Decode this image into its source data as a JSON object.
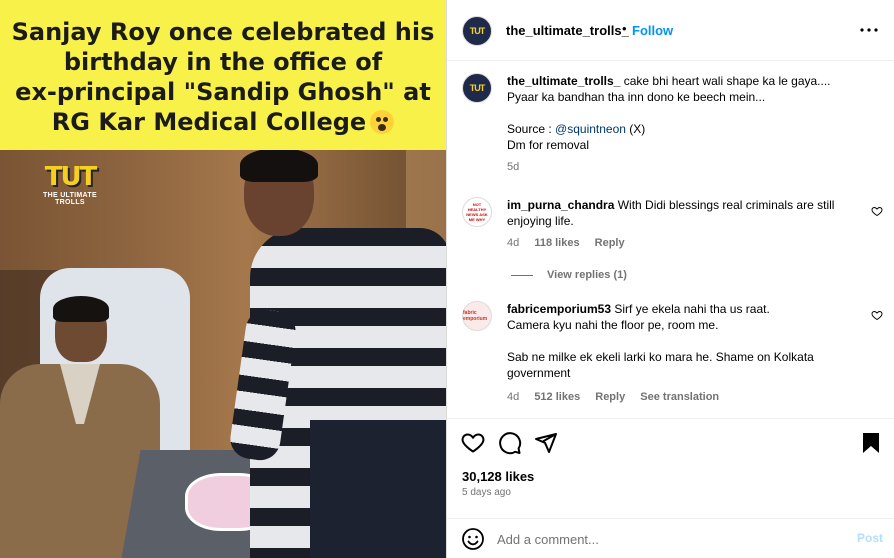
{
  "media": {
    "headline_lines": [
      "Sanjay Roy once celebrated his",
      "birthday in the office of",
      "ex-principal \"Sandip Ghosh\" at",
      "RG Kar Medical College"
    ],
    "emoji": "scream-emoji",
    "watermark_mark": "TUT",
    "watermark_sub": "THE ULTIMATE TROLLS"
  },
  "header": {
    "username": "the_ultimate_trolls_",
    "dot": "•",
    "follow_label": "Follow",
    "avatar_text": "TUT"
  },
  "caption": {
    "username": "the_ultimate_trolls_",
    "line1": "cake bhi heart wali shape ka le gaya....",
    "line2": "Pyaar ka bandhan tha inn dono ke beech mein...",
    "source_label": "Source :",
    "source_handle": "@squintneon",
    "source_suffix": "(X)",
    "dm_line": "Dm for removal",
    "age": "5d",
    "avatar_text": "TUT"
  },
  "comments": [
    {
      "username": "im_purna_chandra",
      "text": "With Didi blessings real criminals are still enjoying life.",
      "age": "4d",
      "likes": "118 likes",
      "reply_label": "Reply",
      "avatar_text": "NOT HEALTHY NEWS ASK ME WHY",
      "view_replies": "View replies (1)"
    },
    {
      "username": "fabricemporium53",
      "line1": "Sirf ye ekela nahi tha us raat.",
      "line2": "Camera kyu nahi the floor pe, room me.",
      "line3": "Sab ne milke ek ekeli larki ko mara he. Shame on Kolkata government",
      "age": "4d",
      "likes": "512 likes",
      "reply_label": "Reply",
      "translation_label": "See translation",
      "avatar_text": "fabric emporium"
    }
  ],
  "actions": {
    "likes_count": "30,128 likes",
    "date": "5 days ago"
  },
  "add_comment": {
    "placeholder": "Add a comment...",
    "post_label": "Post"
  },
  "colors": {
    "accent": "#0095f6",
    "headline_bg": "#f7f14a",
    "muted": "#737373",
    "post_disabled": "#b2dffc"
  }
}
